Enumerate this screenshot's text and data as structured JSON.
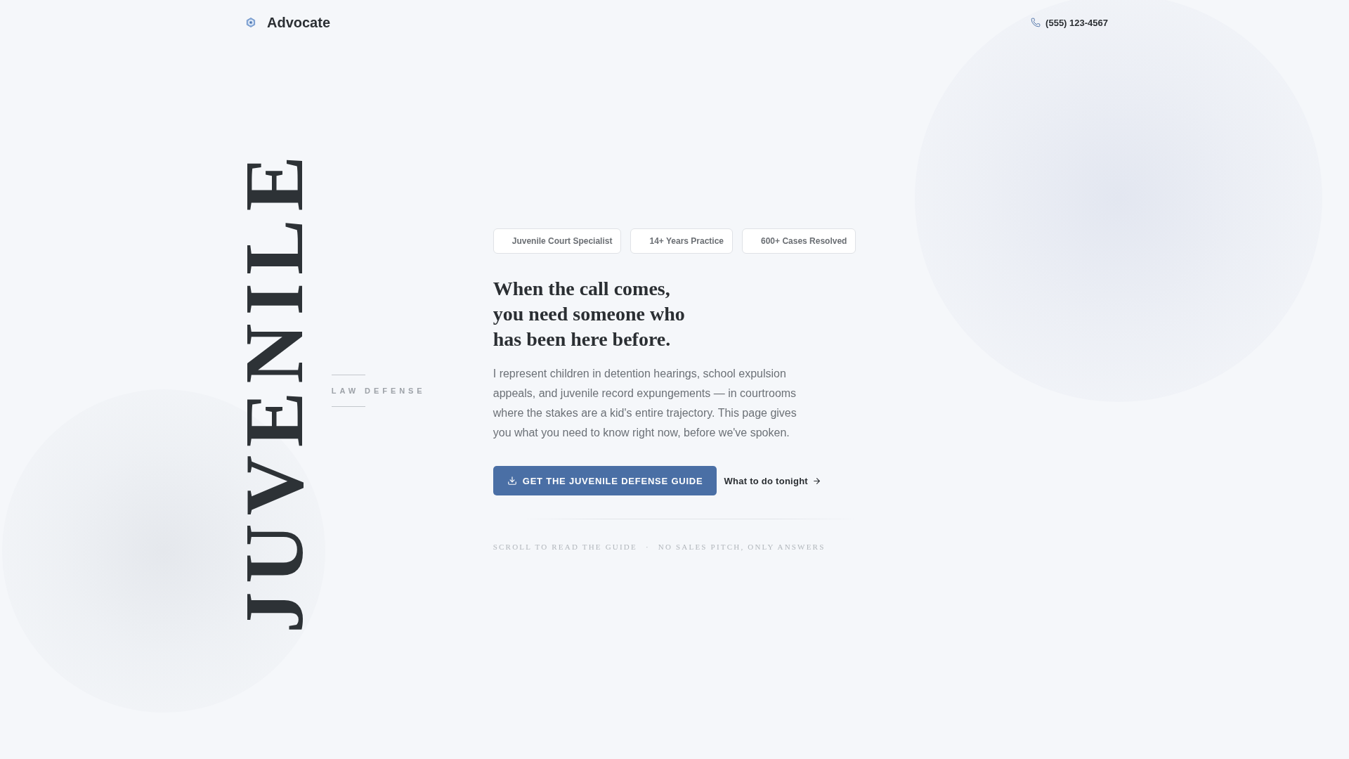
{
  "header": {
    "brand": "Advocate",
    "phone": "(555) 123-4567"
  },
  "hero": {
    "vertical_word": "JUVENILE",
    "side_label": "LAW DEFENSE",
    "badges": [
      "Juvenile Court Specialist",
      "14+ Years Practice",
      "600+ Cases Resolved"
    ],
    "title_lines": [
      "When the call comes,",
      "you need someone who",
      "has been here before."
    ],
    "body": "I represent children in detention hearings, school expulsion appeals, and juvenile record expungements — in courtrooms where the stakes are a kid's entire trajectory. This page gives you what you need to know right now, before we've spoken.",
    "primary_button": "GET THE JUVENILE DEFENSE GUIDE",
    "secondary_link": "What to do tonight",
    "notes": [
      "SCROLL TO READ THE GUIDE",
      "·",
      "NO SALES PITCH, ONLY ANSWERS"
    ]
  }
}
